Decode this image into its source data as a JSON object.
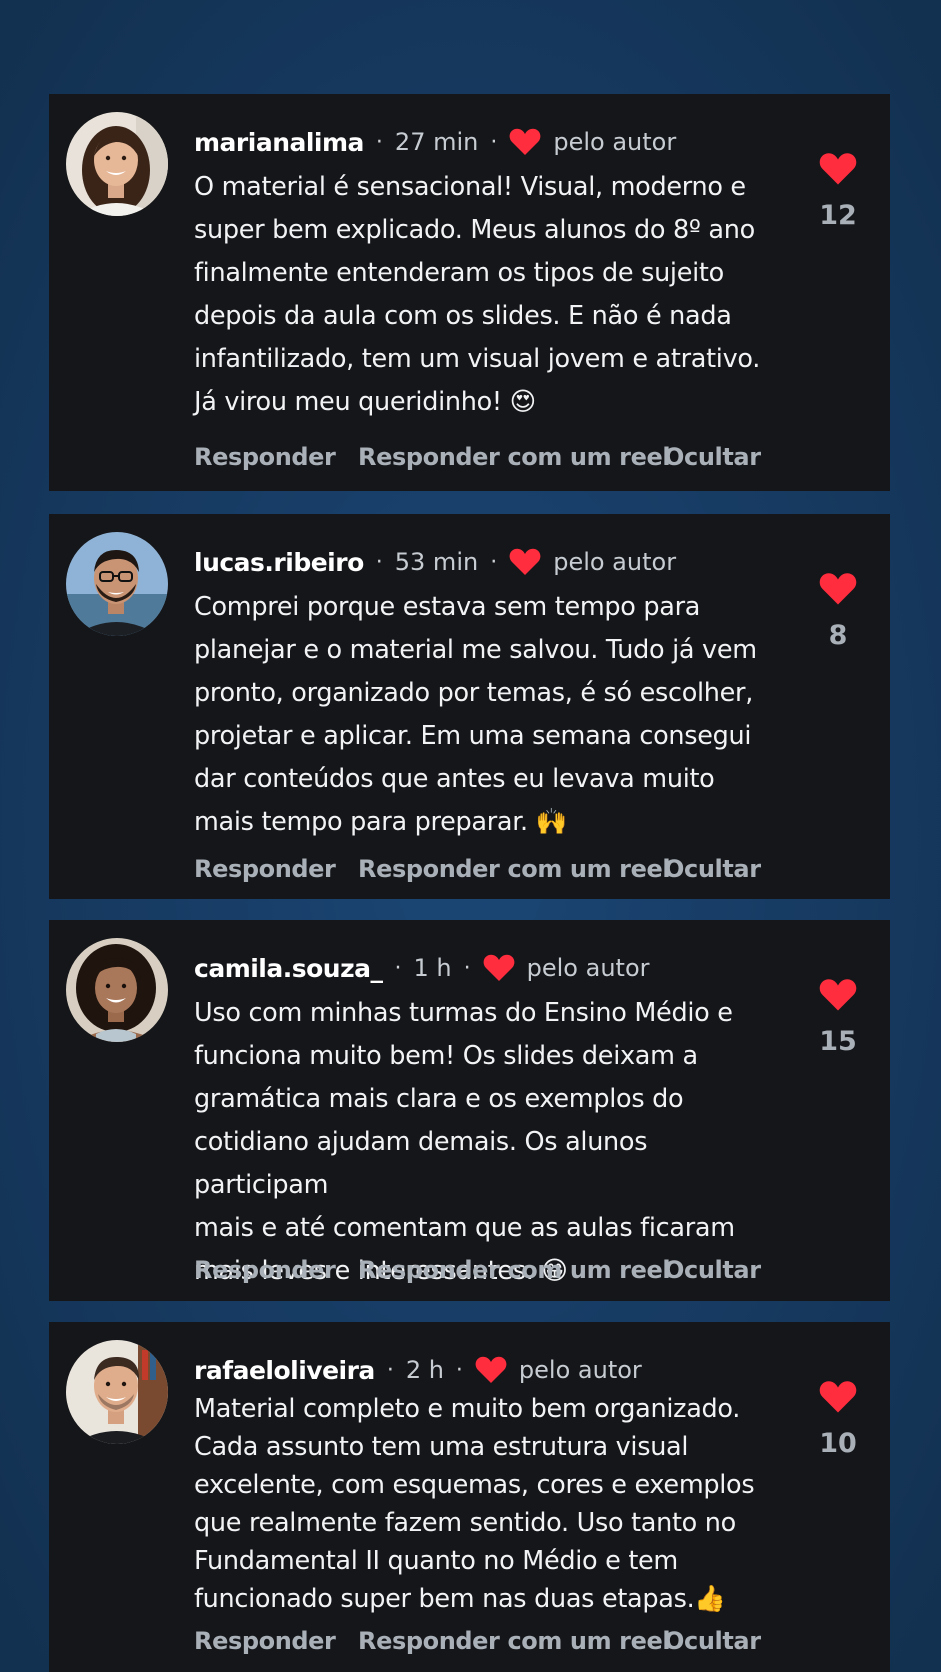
{
  "comments": [
    {
      "username": "marianalima",
      "separator": "·",
      "time": "27 min",
      "author_like_label": "pelo autor",
      "text": "O material é sensacional! Visual, moderno e\nsuper bem explicado. Meus alunos do 8º ano\nfinalmente entenderam os tipos de sujeito\ndepois da aula com os slides. E não é nada\ninfantilizado, tem um visual jovem e atrativo.\nJá virou meu queridinho! 😍",
      "likes": "12",
      "reply_label": "Responder",
      "reply_reel_label": "Responder com um reel",
      "hide_label": "Ocultar"
    },
    {
      "username": "lucas.ribeiro",
      "separator": "·",
      "time": "53 min",
      "author_like_label": "pelo autor",
      "text": "Comprei porque estava sem tempo para\nplanejar e o material me salvou. Tudo já vem\npronto, organizado por temas, é só escolher,\nprojetar e aplicar. Em uma semana consegui\ndar conteúdos que antes eu levava muito\nmais tempo para preparar. 🙌",
      "likes": "8",
      "reply_label": "Responder",
      "reply_reel_label": "Responder com um reel",
      "hide_label": "Ocultar"
    },
    {
      "username": "camila.souza_",
      "separator": "·",
      "time": "1 h",
      "author_like_label": "pelo autor",
      "text": "Uso com minhas turmas do Ensino Médio e\nfunciona muito bem! Os slides deixam a\ngramática mais clara e os exemplos do\ncotidiano ajudam demais. Os alunos participam\nmais e até comentam que as aulas ficaram\nmais leves e interessantes. 😁",
      "likes": "15",
      "reply_label": "Responder",
      "reply_reel_label": "Responder com um reel",
      "hide_label": "Ocultar"
    },
    {
      "username": "rafaeloliveira",
      "separator": "·",
      "time": "2 h",
      "author_like_label": "pelo autor",
      "text": "Material completo e muito bem organizado.\nCada assunto tem uma estrutura visual\nexcelente, com esquemas, cores e exemplos\nque realmente fazem sentido. Uso tanto no\nFundamental II quanto no Médio e tem\nfuncionado super bem nas duas etapas.👍",
      "likes": "10",
      "reply_label": "Responder",
      "reply_reel_label": "Responder com um reel",
      "hide_label": "Ocultar"
    }
  ],
  "colors": {
    "page_background": "#163a63",
    "card_background": "#141619",
    "heart": "#ff2d3d",
    "meta_text": "#c7ccd2",
    "action_text": "#aab0b8"
  },
  "icons": {
    "author_like": "heart-icon",
    "like": "heart-icon"
  }
}
